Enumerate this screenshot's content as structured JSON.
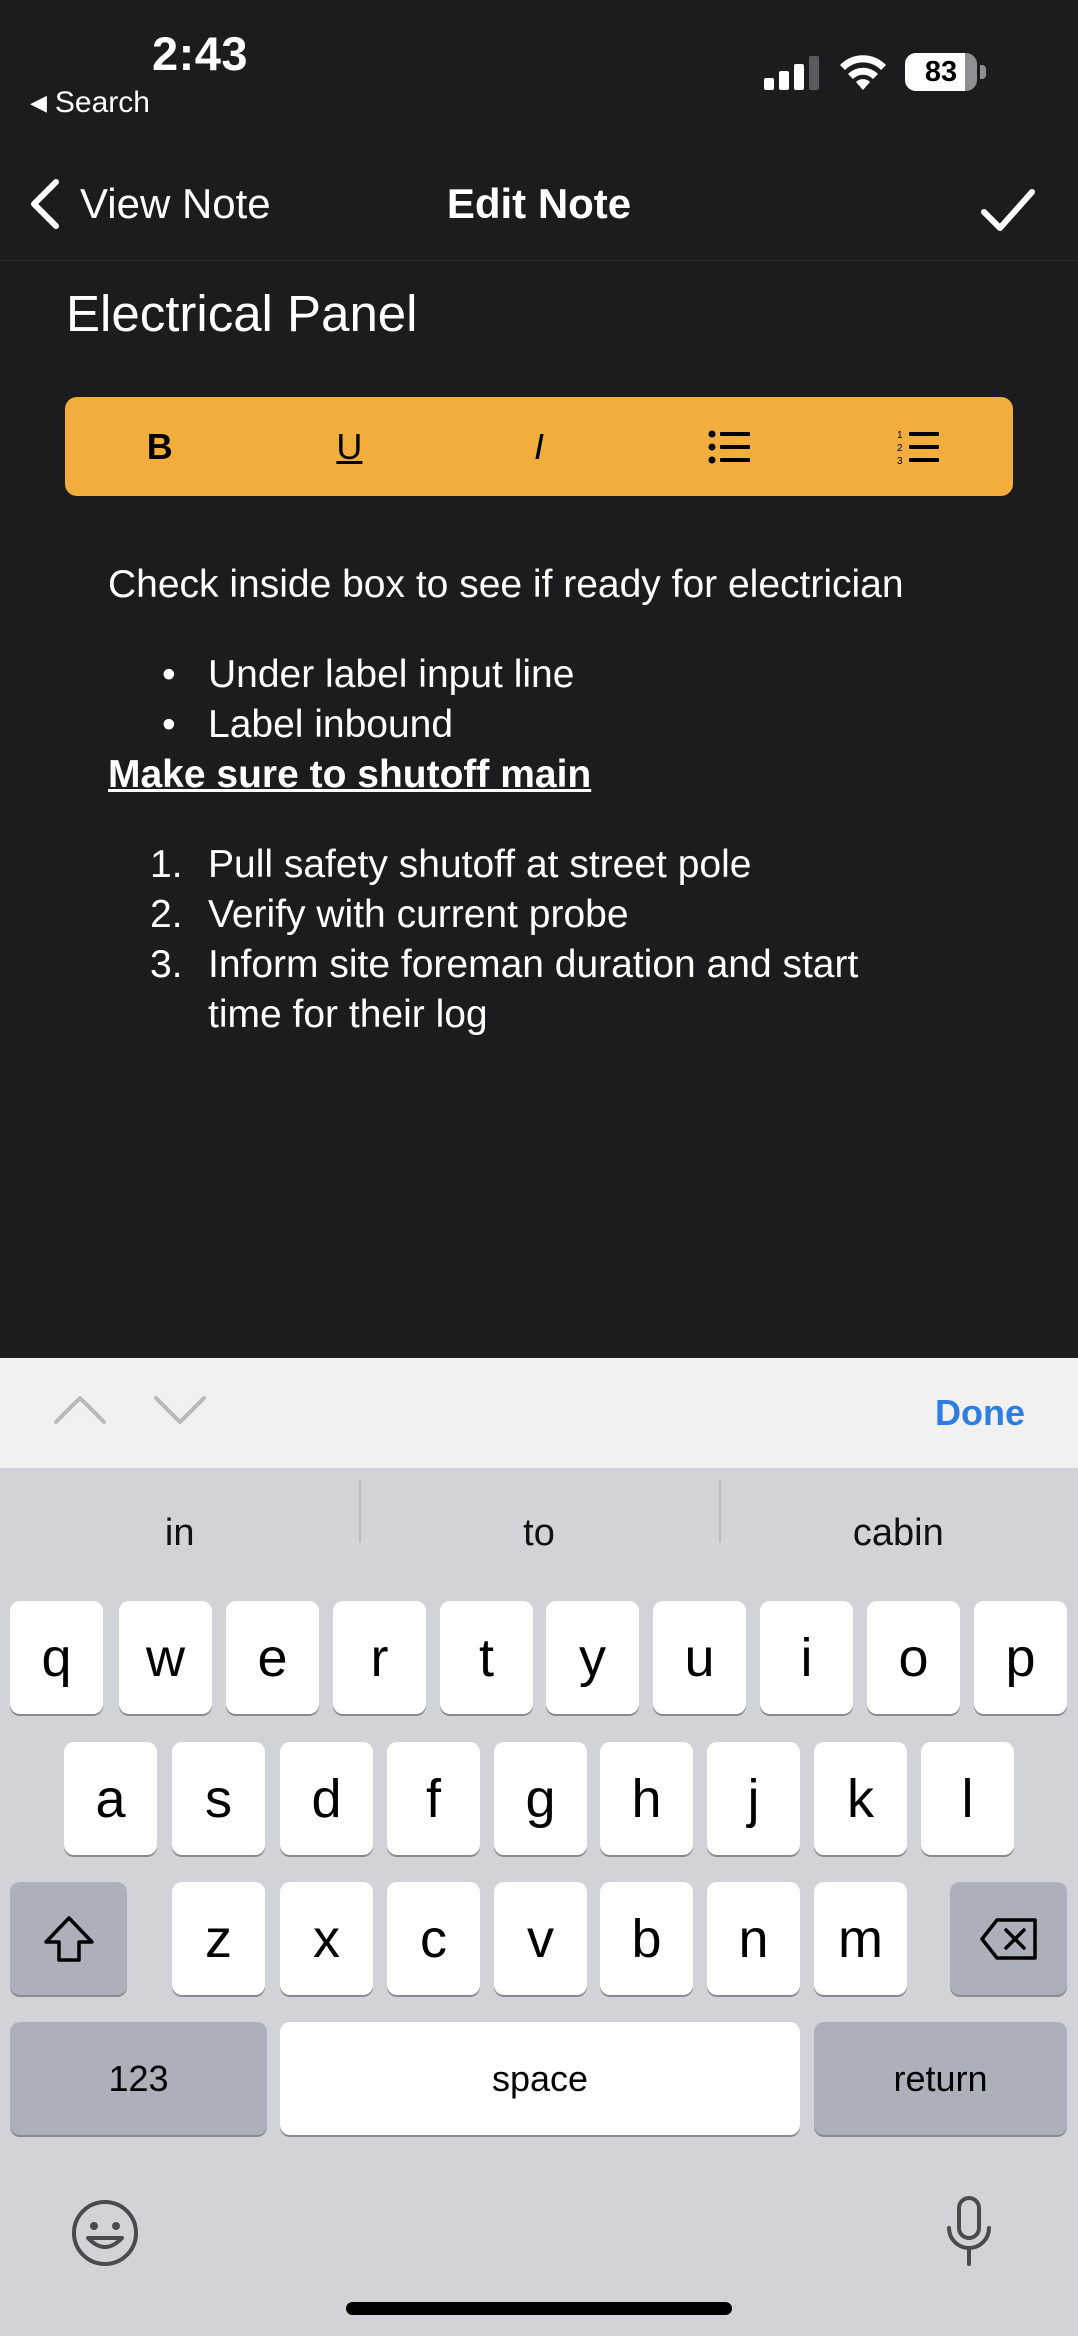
{
  "status_bar": {
    "time": "2:43",
    "back_label": "Search",
    "battery_percent": "83",
    "battery_level": 0.83
  },
  "nav": {
    "back_label": "View Note",
    "title": "Edit Note"
  },
  "note": {
    "title": "Electrical Panel",
    "paragraph": "Check inside box to see if ready for electrician",
    "bullets": [
      "Under label input line",
      "Label inbound"
    ],
    "emphasis": "Make sure to shutoff main",
    "steps": [
      {
        "num": "1.",
        "text": "Pull safety shutoff at street pole"
      },
      {
        "num": "2.",
        "text": "Verify with current probe"
      },
      {
        "num": "3.",
        "text": "Inform site foreman duration and start time for their log"
      }
    ]
  },
  "toolbar": {
    "bold": "B",
    "underline": "U",
    "italic": "I",
    "bulleted_list_icon": "bulleted-list-icon",
    "numbered_list_icon": "numbered-list-icon",
    "color": "#f2ae3d"
  },
  "accessory": {
    "done_label": "Done"
  },
  "keyboard": {
    "suggestions": [
      "in",
      "to",
      "cabin"
    ],
    "row1": [
      "q",
      "w",
      "e",
      "r",
      "t",
      "y",
      "u",
      "i",
      "o",
      "p"
    ],
    "row2": [
      "a",
      "s",
      "d",
      "f",
      "g",
      "h",
      "j",
      "k",
      "l"
    ],
    "row3": [
      "z",
      "x",
      "c",
      "v",
      "b",
      "n",
      "m"
    ],
    "numbers_key": "123",
    "space_key": "space",
    "return_key": "return"
  }
}
